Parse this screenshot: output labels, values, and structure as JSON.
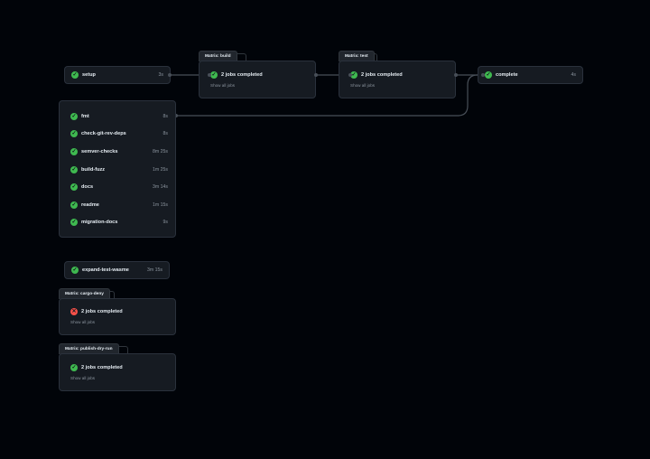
{
  "jobs": {
    "setup": {
      "name": "setup",
      "duration": "3s"
    },
    "complete": {
      "name": "complete",
      "duration": "4s"
    },
    "expand": {
      "name": "expand-test-wasme",
      "duration": "3m 15s"
    }
  },
  "group1": [
    {
      "name": "fmt",
      "duration": "8s"
    },
    {
      "name": "check-git-rev-deps",
      "duration": "8s"
    },
    {
      "name": "semver-checks",
      "duration": "8m 25s"
    },
    {
      "name": "build-fuzz",
      "duration": "1m 25s"
    },
    {
      "name": "docs",
      "duration": "3m 14s"
    },
    {
      "name": "readme",
      "duration": "1m 15s"
    },
    {
      "name": "migration-docs",
      "duration": "9s"
    }
  ],
  "matrices": {
    "build": {
      "title": "Matrix: build",
      "status": "2 jobs completed",
      "link": "Show all jobs"
    },
    "test": {
      "title": "Matrix: test",
      "status": "2 jobs completed",
      "link": "Show all jobs"
    },
    "cargo_deny": {
      "title": "Matrix: cargo-deny",
      "status": "2 jobs completed",
      "link": "Show all jobs"
    },
    "publish": {
      "title": "Matrix: publish-dry-run",
      "status": "2 jobs completed",
      "link": "Show all jobs"
    }
  },
  "colors": {
    "success": "#3fb950",
    "failure": "#f85149",
    "background": "#010409",
    "card": "#161b22"
  }
}
